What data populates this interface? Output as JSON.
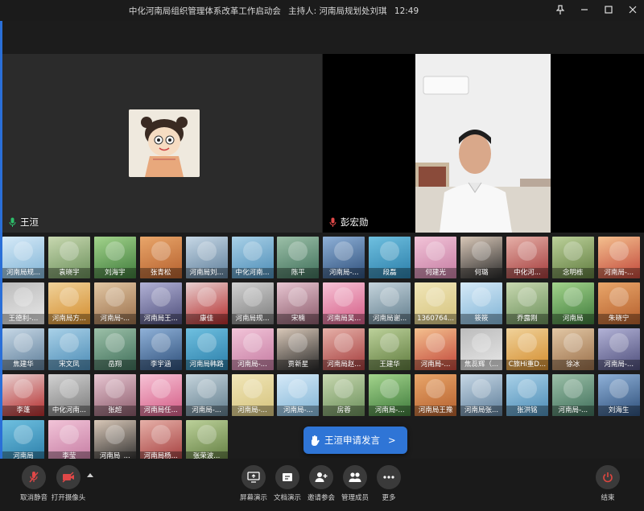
{
  "window": {
    "meeting_title": "中化河南局组织管理体系改革工作启动会",
    "host": "主持人: 河南局规划处刘琪",
    "time": "12:49"
  },
  "main_videos": [
    {
      "name": "王洹",
      "mic": "active"
    },
    {
      "name": "彭宏勋",
      "mic": "muted"
    }
  ],
  "participants": [
    "河南局规...",
    "袁晓宇",
    "刘海宇",
    "张青松",
    "河南局刘...",
    "中化河南...",
    "陈平",
    "河南局-...",
    "段磊",
    "何建光",
    "何璐",
    "中化河...",
    "念明栋",
    "河南局-...",
    "王德利-...",
    "河南局方...",
    "河南局-...",
    "河南局王...",
    "康佳",
    "河南局规...",
    "宋楠",
    "河南局吴...",
    "河南局谢...",
    "1360764...",
    "筱筱",
    "乔露刚",
    "河南局",
    "朱晓宁",
    "焦建华",
    "宋文凤",
    "岳翔",
    "李宇涵",
    "河南局韩路",
    "河南局-...",
    "贾新星",
    "河南局赵...",
    "王建华",
    "河南局-...",
    "焦蕊辉（...",
    "C旅Hi重D...",
    "徐冰",
    "河南局-...",
    "李蓬",
    "中化河南...",
    "张超",
    "河南局任...",
    "河南局-...",
    "河南局-...",
    "河南局-...",
    "房蓉",
    "河南局-...",
    "河南局王豫",
    "河南局张...",
    "张洪铭",
    "河南局-...",
    "刘海生",
    "河南局",
    "李莹",
    "河南局_...",
    "河南局杨...",
    "张荣波..."
  ],
  "raise_hand": {
    "text": "王洹申请发言",
    "arrow": ">"
  },
  "toolbar": {
    "unmute": "取消静音",
    "camera": "打开摄像头",
    "share": "屏幕演示",
    "doc": "文档演示",
    "invite": "邀请参会",
    "members": "管理成员",
    "more": "更多",
    "end": "结束"
  },
  "icons": {
    "pin": "pin-icon",
    "minimize": "minimize-icon",
    "maximize": "maximize-icon",
    "close": "close-icon",
    "mic": "mic-icon",
    "mic_muted": "mic-muted-icon",
    "camera_off": "camera-off-icon",
    "share_screen": "share-screen-icon",
    "document": "document-icon",
    "invite": "add-user-icon",
    "members": "members-icon",
    "more": "more-icon",
    "power": "power-icon",
    "hand": "hand-icon"
  },
  "colors": {
    "accent": "#2f75d6",
    "danger": "#e0463f",
    "mic_active": "#2dbf6a",
    "mic_muted": "#e04848"
  }
}
